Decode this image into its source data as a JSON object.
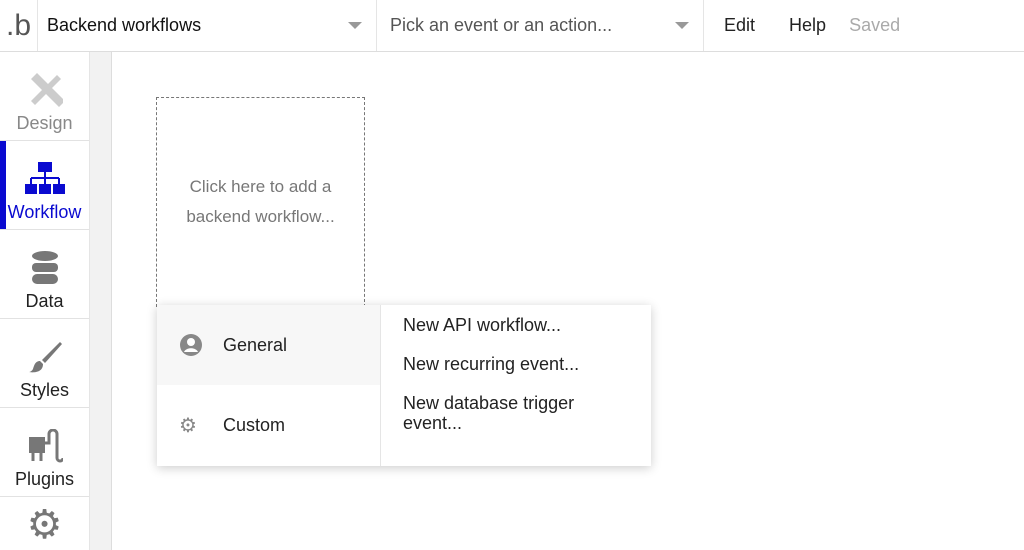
{
  "header": {
    "logo": ".b",
    "page_select": "Backend workflows",
    "event_placeholder": "Pick an event or an action...",
    "menu": {
      "edit": "Edit",
      "help": "Help",
      "status": "Saved"
    }
  },
  "sidebar": {
    "items": [
      {
        "label": "Design"
      },
      {
        "label": "Workflow"
      },
      {
        "label": "Data"
      },
      {
        "label": "Styles"
      },
      {
        "label": "Plugins"
      }
    ]
  },
  "canvas": {
    "placeholder": "Click here to add a backend workflow..."
  },
  "popup": {
    "categories": [
      {
        "label": "General"
      },
      {
        "label": "Custom"
      }
    ],
    "options": [
      "New API workflow...",
      "New recurring event...",
      "New database trigger event..."
    ]
  },
  "colors": {
    "accent": "#0a0ad0"
  }
}
